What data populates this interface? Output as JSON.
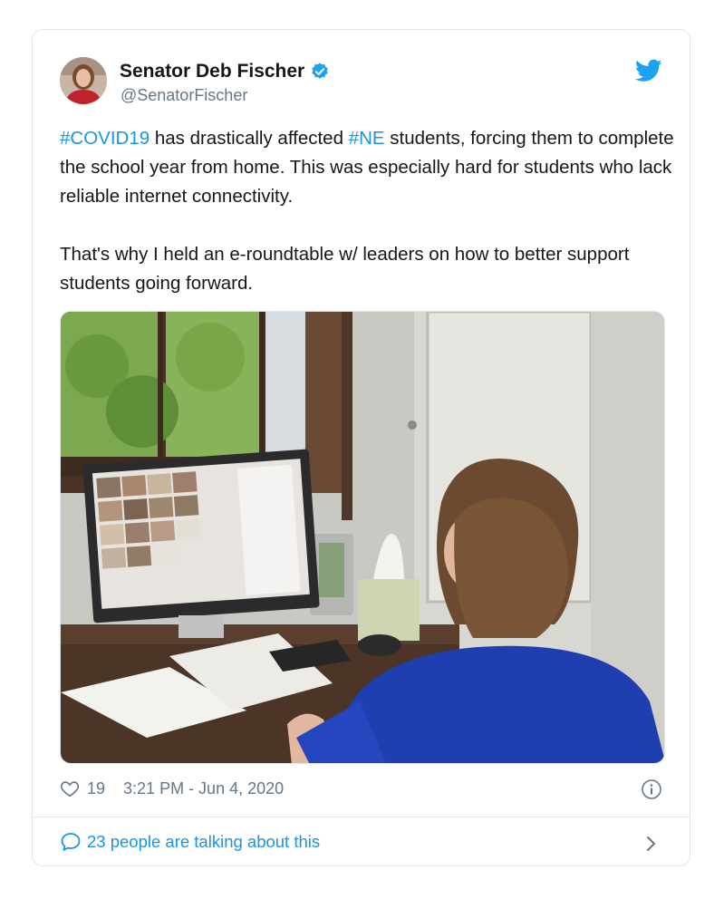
{
  "author": {
    "display_name": "Senator Deb Fischer",
    "handle": "@SenatorFischer",
    "verified": true
  },
  "tweet": {
    "segments_p1": [
      {
        "text": "#COVID19",
        "tag": true
      },
      {
        "text": " has drastically affected ",
        "tag": false
      },
      {
        "text": "#NE",
        "tag": true
      },
      {
        "text": " students, forcing them to complete the school year from home. This was especially hard for students who lack reliable internet connectivity.",
        "tag": false
      }
    ],
    "paragraph_2": "That's why I held an e-roundtable w/ leaders on how to better support students going forward."
  },
  "meta": {
    "likes": "19",
    "timestamp": "3:21 PM - Jun 4, 2020"
  },
  "conversation": {
    "label": "23 people are talking about this"
  },
  "colors": {
    "link": "#1b95e0",
    "secondary": "#657786",
    "border": "#e1e8ed",
    "twitter_blue": "#1da1f2"
  },
  "icons": [
    "verified-badge-icon",
    "twitter-bird-icon",
    "heart-icon",
    "info-icon",
    "speech-bubble-icon",
    "chevron-right-icon"
  ]
}
